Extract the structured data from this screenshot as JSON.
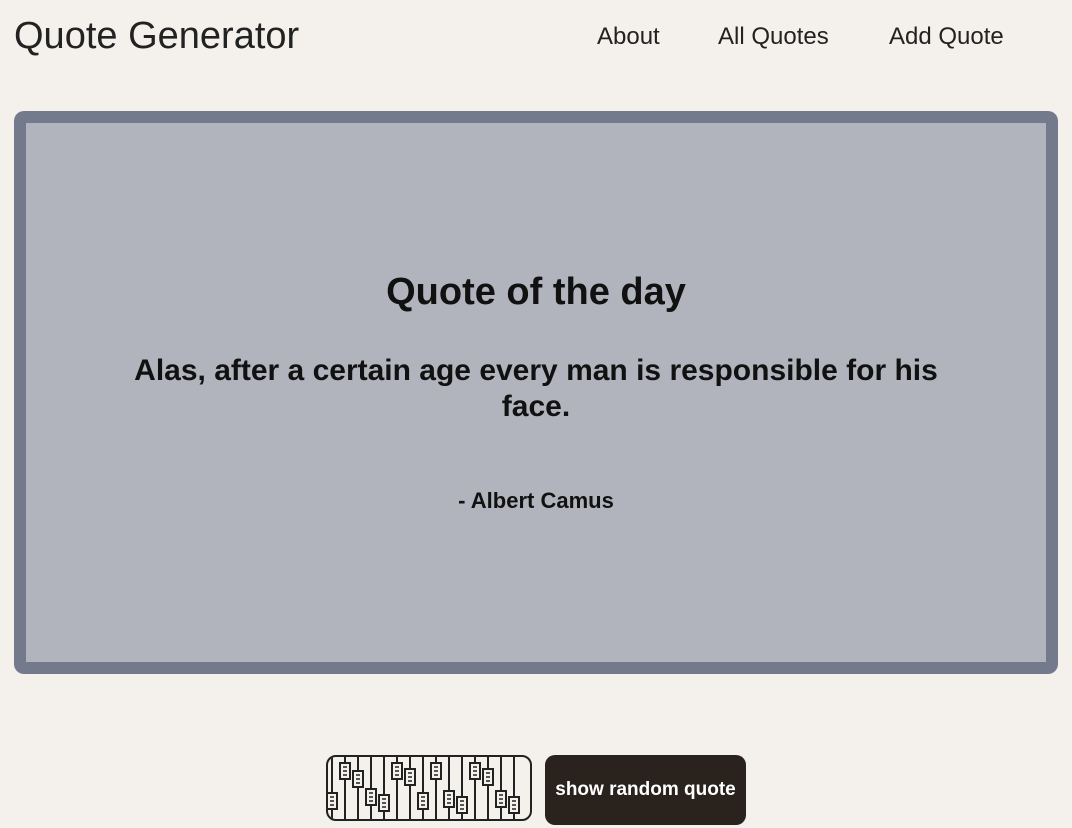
{
  "header": {
    "site_title": "Quote Generator",
    "nav": {
      "about": "About",
      "all_quotes": "All Quotes",
      "add_quote": "Add Quote"
    }
  },
  "quote_card": {
    "heading": "Quote of the day",
    "text": "Alas, after a certain age every man is responsible for his face.",
    "author": "- Albert Camus"
  },
  "controls": {
    "icon": "sliders-icon",
    "random_button_label": "show random quote"
  },
  "colors": {
    "page_background": "#f4f1ec",
    "card_border": "#737a8c",
    "card_background": "#b1b4bd",
    "button_background": "#2a221c",
    "button_text": "#ffffff"
  }
}
